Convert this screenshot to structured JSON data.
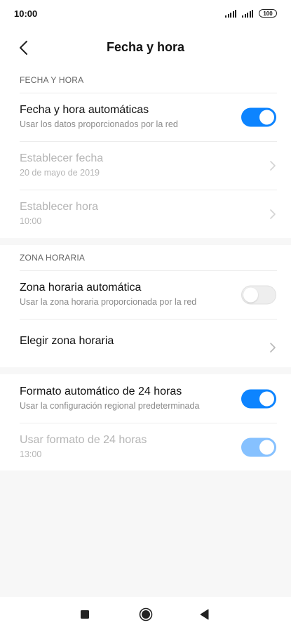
{
  "status_bar": {
    "time": "10:00",
    "battery": "100"
  },
  "header": {
    "title": "Fecha y hora",
    "back_icon": "back-chevron-icon"
  },
  "sections": {
    "date_time": {
      "header": "FECHA Y HORA",
      "auto_datetime": {
        "title": "Fecha y hora automáticas",
        "subtitle": "Usar los datos proporcionados por la red",
        "enabled": true
      },
      "set_date": {
        "title": "Establecer fecha",
        "value": "20 de mayo de 2019"
      },
      "set_time": {
        "title": "Establecer hora",
        "value": "10:00"
      }
    },
    "time_zone": {
      "header": "ZONA HORARIA",
      "auto_zone": {
        "title": "Zona horaria automática",
        "subtitle": "Usar la zona horaria proporcionada por la red",
        "enabled": false
      },
      "choose_zone": {
        "title": "Elegir zona horaria"
      }
    },
    "format": {
      "auto_24h": {
        "title": "Formato automático de 24 horas",
        "subtitle": "Usar la configuración regional predeterminada",
        "enabled": true
      },
      "use_24h": {
        "title": "Usar formato de 24 horas",
        "value": "13:00",
        "enabled": true
      }
    }
  },
  "colors": {
    "accent": "#0d84ff",
    "accent_disabled": "#86c1ff",
    "background": "#f7f7f7"
  },
  "nav_bar": {
    "icons": [
      "recents-square-icon",
      "home-circle-icon",
      "back-triangle-icon"
    ]
  }
}
